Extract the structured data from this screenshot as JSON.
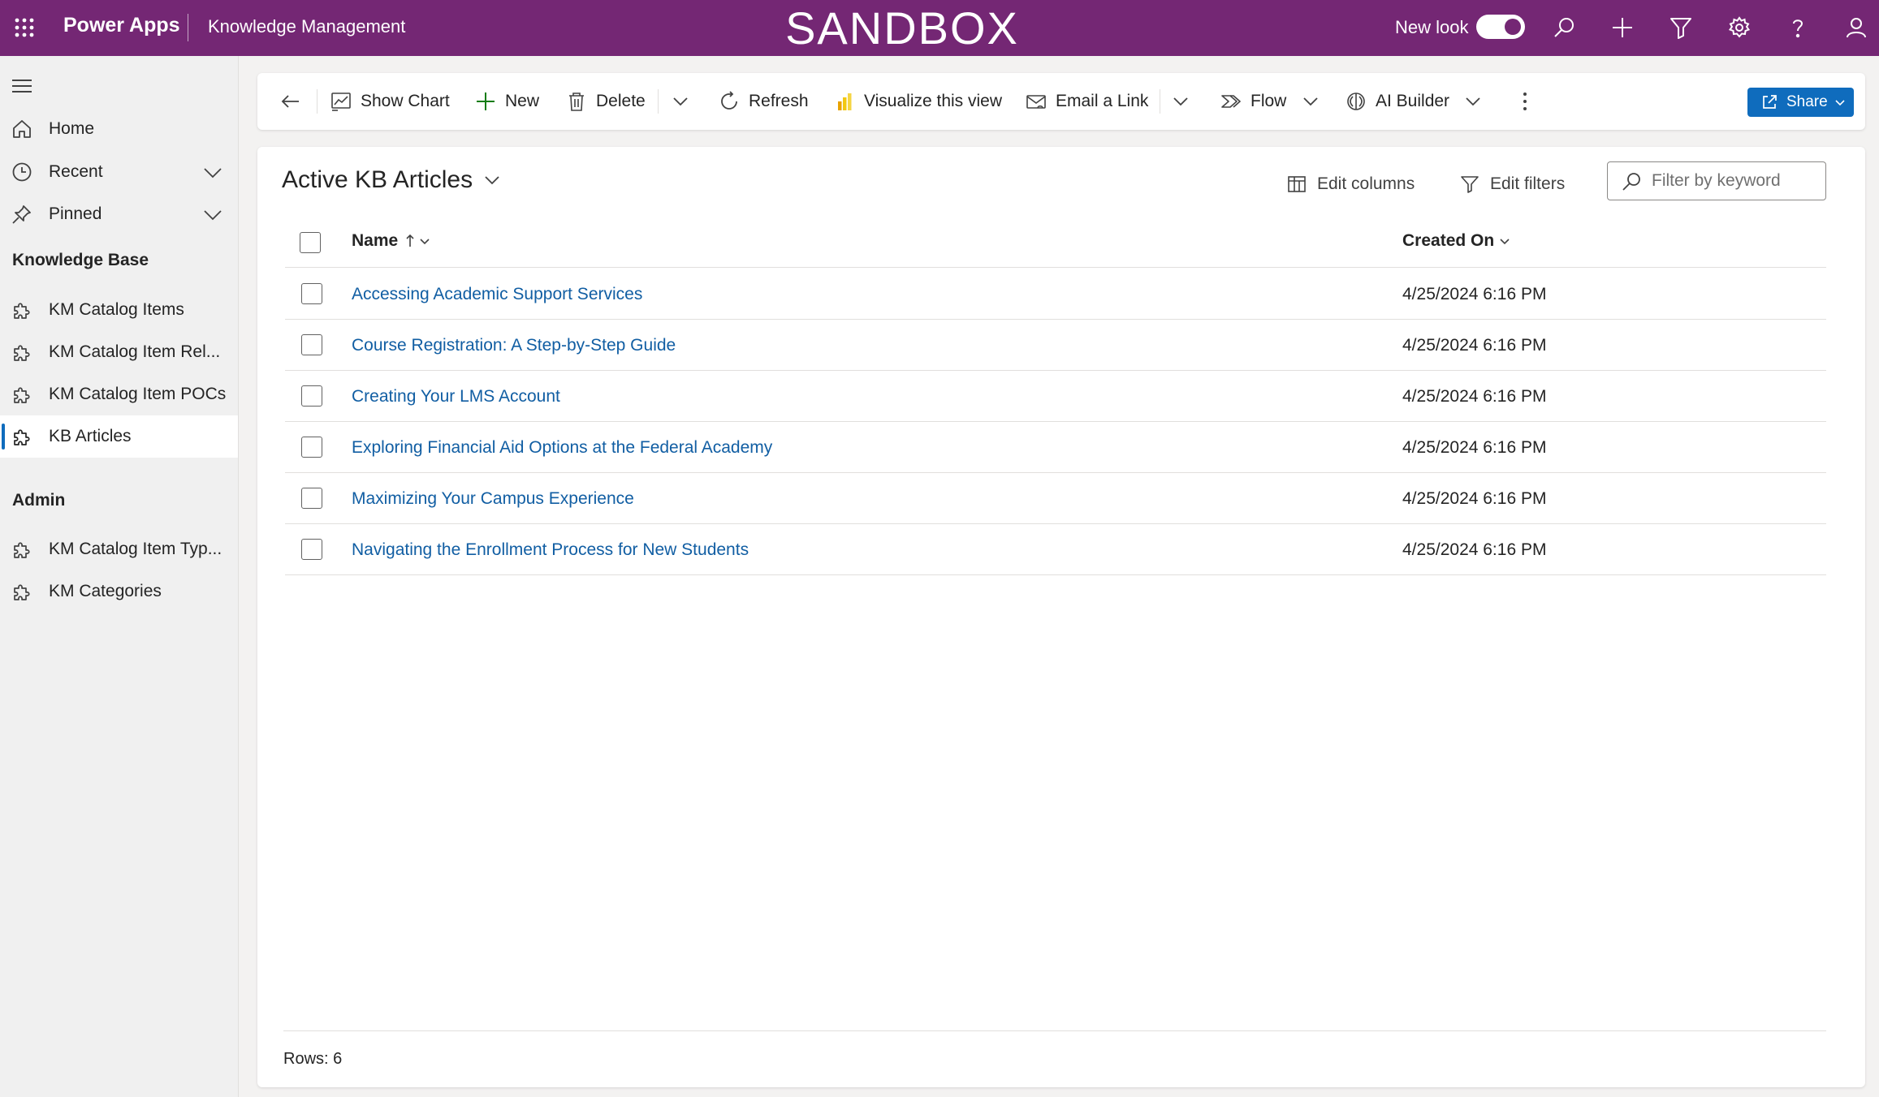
{
  "header": {
    "app_name": "Power Apps",
    "environment": "Knowledge Management",
    "banner": "SANDBOX",
    "new_look_label": "New look",
    "new_look_on": true,
    "brand_color": "#742774",
    "icons": [
      "waffle-icon",
      "search-icon",
      "plus-icon",
      "filter-icon",
      "settings-icon",
      "help-icon",
      "user-icon"
    ]
  },
  "sidebar": {
    "items": [
      {
        "label": "Home",
        "icon": "home-icon"
      },
      {
        "label": "Recent",
        "icon": "clock-icon",
        "expandable": true
      },
      {
        "label": "Pinned",
        "icon": "pin-icon",
        "expandable": true
      }
    ],
    "sections": [
      {
        "title": "Knowledge Base",
        "items": [
          {
            "label": "KM Catalog Items",
            "icon": "puzzle-icon"
          },
          {
            "label": "KM Catalog Item Rel...",
            "icon": "puzzle-icon"
          },
          {
            "label": "KM Catalog Item POCs",
            "icon": "puzzle-icon"
          },
          {
            "label": "KB Articles",
            "icon": "puzzle-icon",
            "active": true
          }
        ]
      },
      {
        "title": "Admin",
        "items": [
          {
            "label": "KM Catalog Item Typ...",
            "icon": "puzzle-icon"
          },
          {
            "label": "KM Categories",
            "icon": "puzzle-icon"
          }
        ]
      }
    ]
  },
  "commandbar": {
    "show_chart": "Show Chart",
    "new": "New",
    "delete": "Delete",
    "refresh": "Refresh",
    "visualize": "Visualize this view",
    "email_link": "Email a Link",
    "flow": "Flow",
    "ai_builder": "AI Builder",
    "share": "Share"
  },
  "view": {
    "title": "Active KB Articles",
    "edit_columns": "Edit columns",
    "edit_filters": "Edit filters",
    "search_placeholder": "Filter by keyword"
  },
  "grid": {
    "columns": {
      "name": "Name",
      "created_on": "Created On"
    },
    "rows": [
      {
        "name": "Accessing Academic Support Services",
        "created_on": "4/25/2024 6:16 PM"
      },
      {
        "name": "Course Registration: A Step-by-Step Guide",
        "created_on": "4/25/2024 6:16 PM"
      },
      {
        "name": "Creating Your LMS Account",
        "created_on": "4/25/2024 6:16 PM"
      },
      {
        "name": "Exploring Financial Aid Options at the Federal Academy",
        "created_on": "4/25/2024 6:16 PM"
      },
      {
        "name": "Maximizing Your Campus Experience",
        "created_on": "4/25/2024 6:16 PM"
      },
      {
        "name": "Navigating the Enrollment Process for New Students",
        "created_on": "4/25/2024 6:16 PM"
      }
    ],
    "footer": "Rows: 6"
  }
}
